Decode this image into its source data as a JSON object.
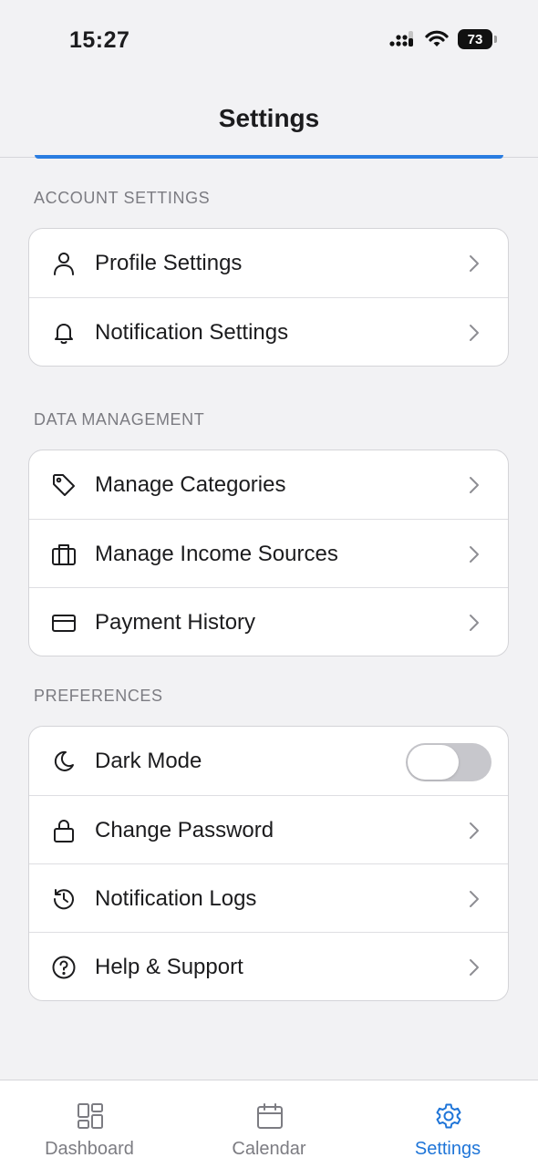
{
  "status_bar": {
    "time": "15:27",
    "battery": "73"
  },
  "header": {
    "title": "Settings"
  },
  "sections": {
    "account": {
      "title": "ACCOUNT SETTINGS",
      "items": [
        {
          "label": "Profile Settings",
          "icon": "user-icon"
        },
        {
          "label": "Notification Settings",
          "icon": "bell-icon"
        }
      ]
    },
    "data": {
      "title": "DATA MANAGEMENT",
      "items": [
        {
          "label": "Manage Categories",
          "icon": "tag-icon"
        },
        {
          "label": "Manage Income Sources",
          "icon": "briefcase-icon"
        },
        {
          "label": "Payment History",
          "icon": "credit-card-icon"
        }
      ]
    },
    "preferences": {
      "title": "PREFERENCES",
      "items": [
        {
          "label": "Dark Mode",
          "icon": "moon-icon",
          "toggle": false
        },
        {
          "label": "Change Password",
          "icon": "lock-icon"
        },
        {
          "label": "Notification Logs",
          "icon": "history-icon"
        },
        {
          "label": "Help & Support",
          "icon": "help-circle-icon"
        }
      ]
    }
  },
  "tab_bar": {
    "tabs": [
      {
        "label": "Dashboard",
        "icon": "dashboard-icon",
        "active": false
      },
      {
        "label": "Calendar",
        "icon": "calendar-icon",
        "active": false
      },
      {
        "label": "Settings",
        "icon": "gear-icon",
        "active": true
      }
    ]
  },
  "colors": {
    "accent": "#1f75d8",
    "background": "#f2f2f4",
    "toggle_off": "#c7c7cc"
  }
}
